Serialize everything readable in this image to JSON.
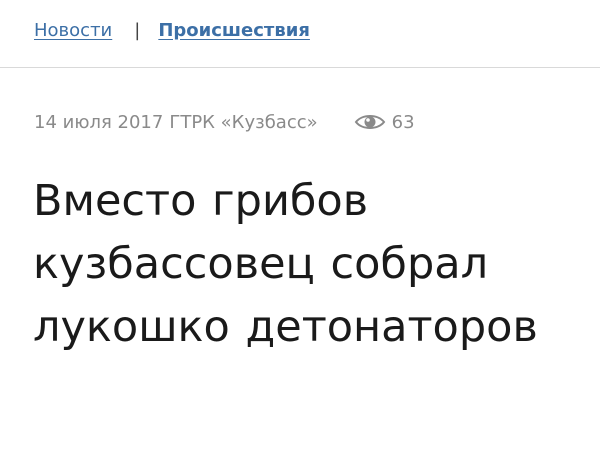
{
  "breadcrumb": {
    "home_label": "Новости",
    "separator": "|",
    "section_label": "Происшествия"
  },
  "meta": {
    "date": "14 июля 2017",
    "source": "ГТРК «Кузбасс»",
    "views_icon": "eye-icon",
    "views_count": "63"
  },
  "article": {
    "headline": "Вместо грибов кузбассовец собрал лукошко детонаторов"
  },
  "colors": {
    "link": "#3c6fa6",
    "meta_text": "#8a8a8a",
    "headline_text": "#1a1a1a",
    "divider": "#d9d9d9"
  }
}
